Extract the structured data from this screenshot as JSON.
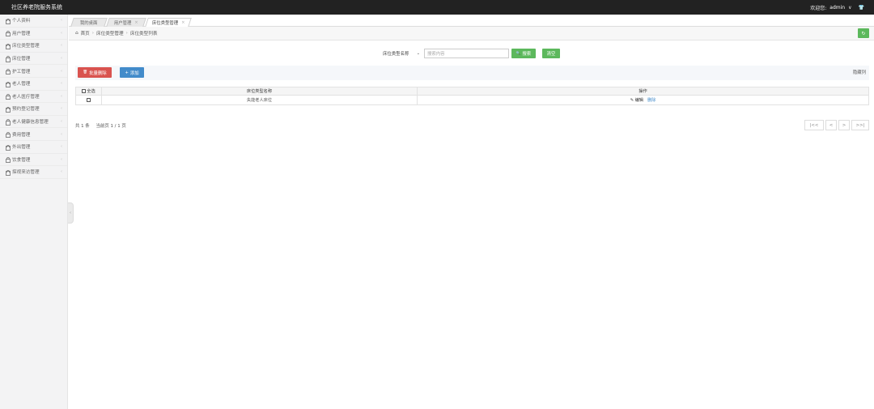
{
  "app": {
    "title": "社区养老院服务系统"
  },
  "topbar": {
    "welcome": "欢迎您: ",
    "user": "admin",
    "dropdown_glyph": "∨",
    "shirt_glyph": "👕"
  },
  "sidebar": {
    "items": [
      {
        "label": "个人资料"
      },
      {
        "label": "用户管理"
      },
      {
        "label": "床位类型管理"
      },
      {
        "label": "床位管理"
      },
      {
        "label": "护工管理"
      },
      {
        "label": "老人管理"
      },
      {
        "label": "老人医疗管理"
      },
      {
        "label": "预约登记管理"
      },
      {
        "label": "老人健康信息管理"
      },
      {
        "label": "费用管理"
      },
      {
        "label": "外出管理"
      },
      {
        "label": "饮食管理"
      },
      {
        "label": "探视来访管理"
      }
    ],
    "chevron": "‹",
    "collapse_glyph": "‹"
  },
  "tabs": [
    {
      "label": "我的桌面",
      "closable": false
    },
    {
      "label": "用户管理",
      "closable": true
    },
    {
      "label": "床位类型管理",
      "closable": true,
      "active": true
    }
  ],
  "tab_close_glyph": "×",
  "breadcrumb": {
    "home_icon": "⌂",
    "home": "首页",
    "sep": "›",
    "level1": "床位类型管理",
    "level2": "床位类型列表"
  },
  "refresh_glyph": "↻",
  "search": {
    "select_value": "床位类型名称",
    "caret": "⌄",
    "placeholder": "搜索内容",
    "search_label": "搜索",
    "search_icon": "🔍",
    "reset_label": "清空"
  },
  "toolbar": {
    "batch_delete_icon": "🗑",
    "batch_delete_label": "批量删除",
    "add_icon": "+",
    "add_label": "添加",
    "toggle_columns_label": "隐藏列"
  },
  "table": {
    "headers": {
      "select_all": "全选",
      "name": "床位类型名称",
      "actions": "操作"
    },
    "rows": [
      {
        "name": "失能老人床位",
        "edit_icon": "✎",
        "edit_label": "编辑",
        "delete_label": "删除"
      }
    ]
  },
  "pagination": {
    "total": "共 1 条",
    "page": "当前页 1 / 1 页",
    "first": "|<<",
    "prev": "<",
    "next": ">",
    "last": ">>|"
  }
}
